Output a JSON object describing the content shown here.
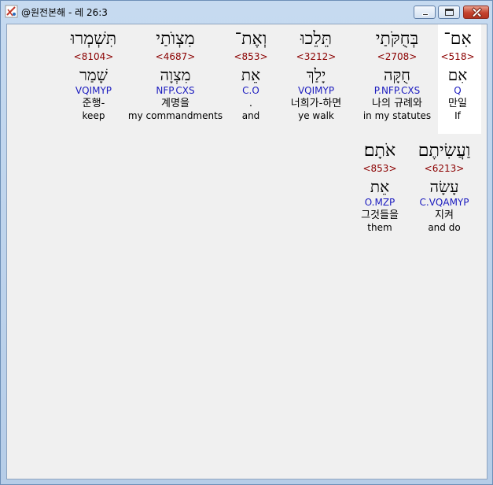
{
  "window": {
    "title": "@원전본해 - 레 26:3",
    "icon": "app-icon"
  },
  "verses": [
    {
      "words": [
        {
          "hebrew": "אִם־",
          "strong": "<518>",
          "lemma": "אִם",
          "parse": "Q",
          "korean": "만일",
          "english": "If",
          "highlighted": true
        },
        {
          "hebrew": "בְּחֻקֹּתַי",
          "strong": "<2708>",
          "lemma": "חֻקָּה",
          "parse": "P.NFP.CXS",
          "korean": "나의 규례와",
          "english": "in my statutes"
        },
        {
          "hebrew": "תֵּלֵכוּ",
          "strong": "<3212>",
          "lemma": "יָלַךְ",
          "parse": "VQIMYP",
          "korean": "너희가-하면",
          "english": "ye walk"
        },
        {
          "hebrew": "וְאֶת־",
          "strong": "<853>",
          "lemma": "אֵת",
          "parse": "C.O",
          "korean": ".",
          "english": "and"
        },
        {
          "hebrew": "מִצְוֺתַי",
          "strong": "<4687>",
          "lemma": "מִצְוָה",
          "parse": "NFP.CXS",
          "korean": "계명을",
          "english": "my commandments"
        },
        {
          "hebrew": "תִּשְׁמְרוּ",
          "strong": "<8104>",
          "lemma": "שָׁמַר",
          "parse": "VQIMYP",
          "korean": "준행-",
          "english": "keep"
        }
      ]
    },
    {
      "words": [
        {
          "hebrew": "וַעֲשִׂיתֶם",
          "strong": "<6213>",
          "lemma": "עָשָׂה",
          "parse": "C.VQAMYP",
          "korean": "지켜",
          "english": "and do"
        },
        {
          "hebrew": "אֹתָם׃",
          "strong": "<853>",
          "lemma": "אֵת",
          "parse": "O.MZP",
          "korean": "그것들을",
          "english": "them"
        }
      ]
    }
  ]
}
